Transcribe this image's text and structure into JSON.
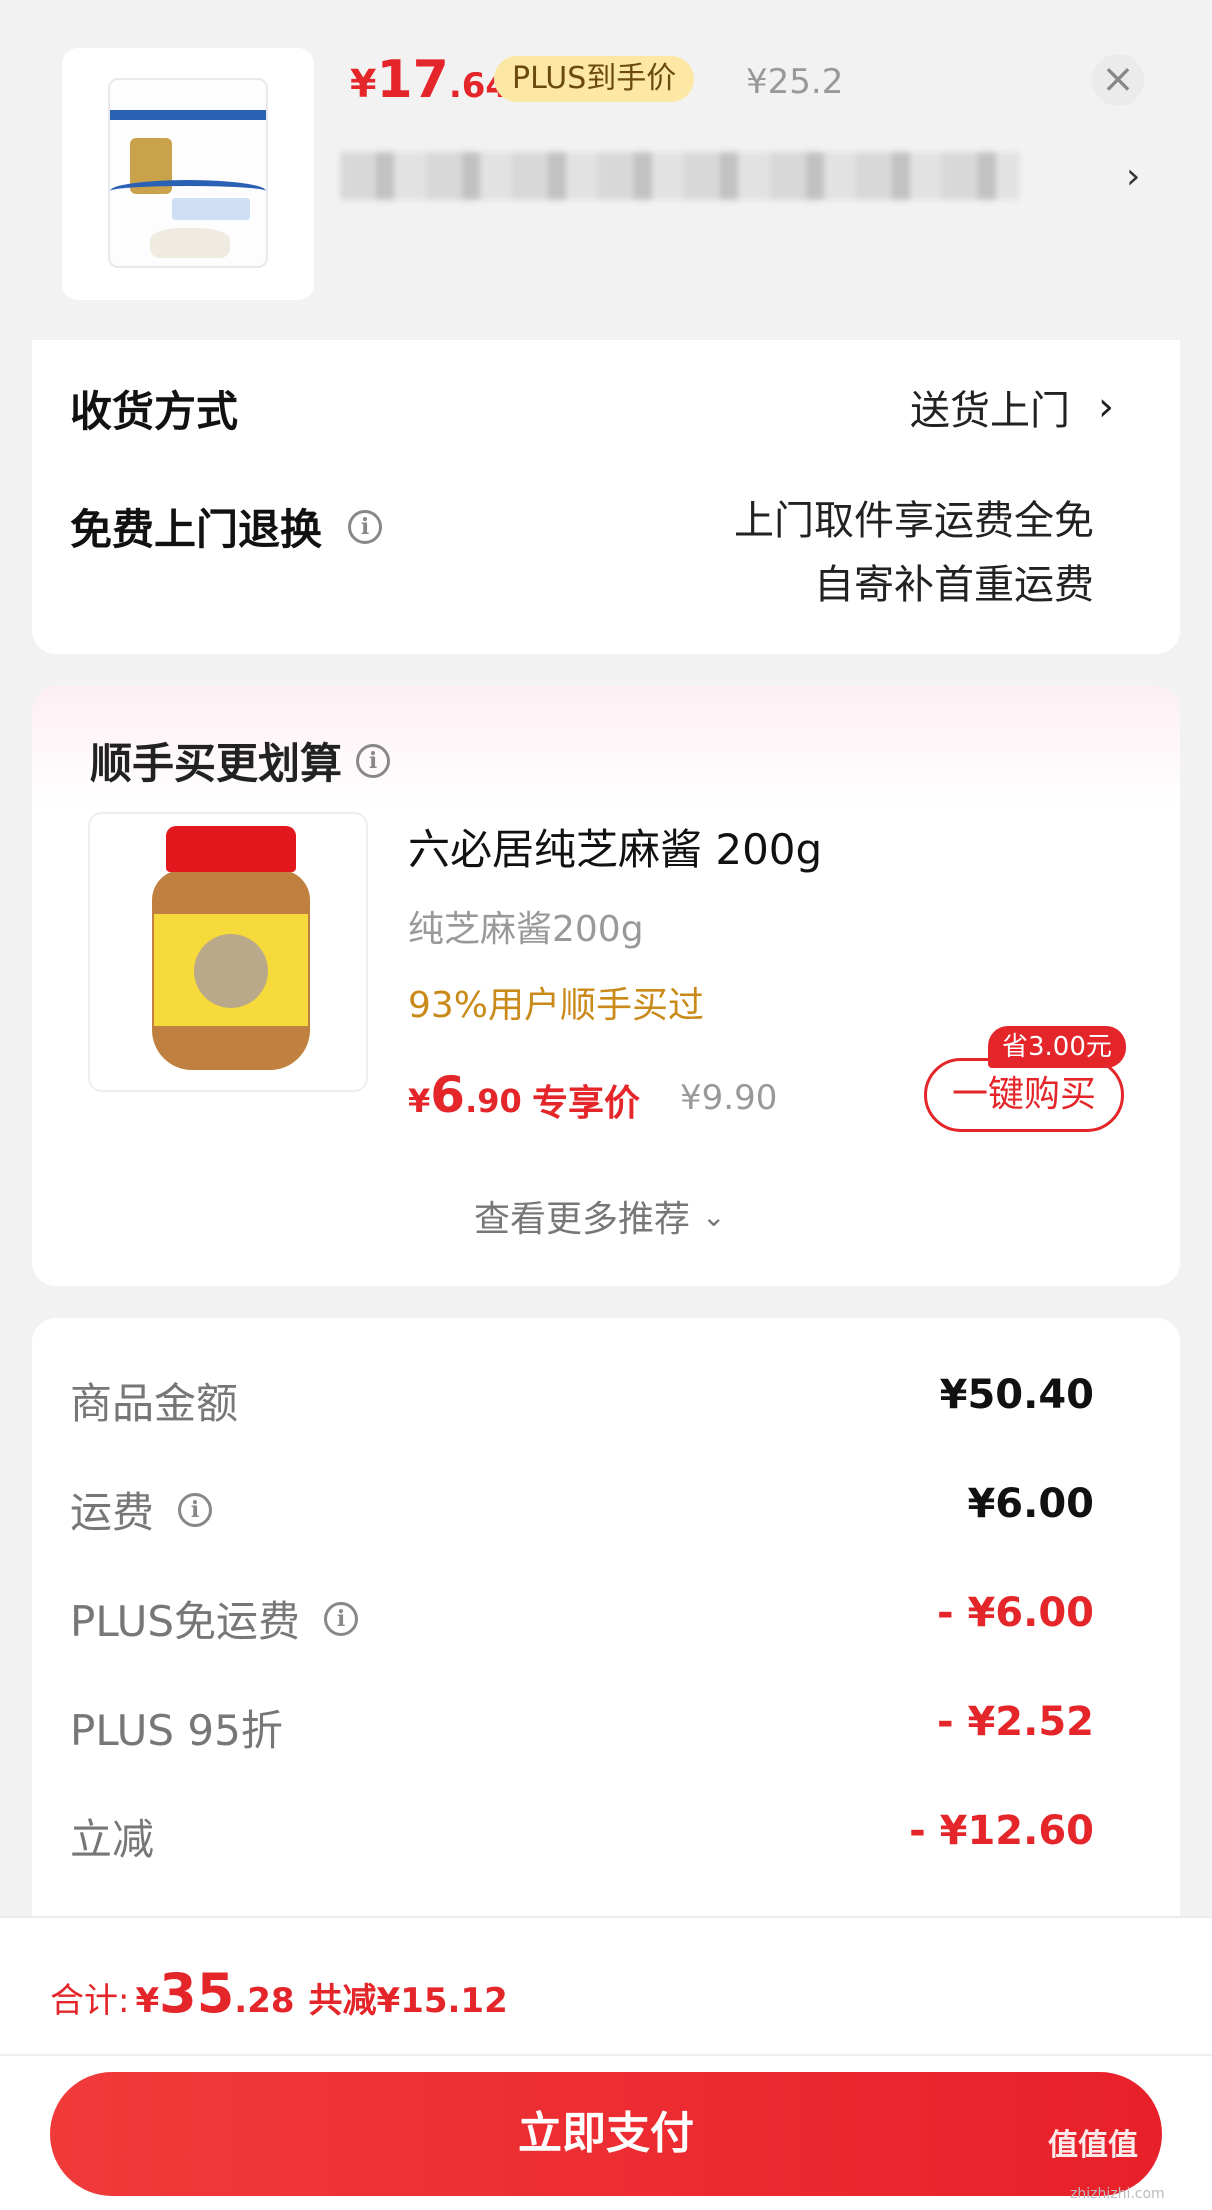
{
  "header": {
    "price_symbol": "¥",
    "price_int": "17",
    "price_dec": ".64",
    "plus_badge": "PLUS到手价",
    "original_price": "¥25.2",
    "close_icon": "close-icon",
    "chevron_icon": "chevron-right-icon"
  },
  "delivery": {
    "method_label": "收货方式",
    "method_value": "送货上门",
    "return_label": "免费上门退换",
    "return_line1": "上门取件享运费全免",
    "return_line2": "自寄补首重运费"
  },
  "addon": {
    "title": "顺手买更划算",
    "product_name": "六必居纯芝麻酱 200g",
    "product_spec": "纯芝麻酱200g",
    "bought_rate": "93%用户顺手买过",
    "price_symbol": "¥",
    "price_int": "6",
    "price_dec": ".90",
    "price_tag": "专享价",
    "original_price": "¥9.90",
    "save_badge": "省3.00元",
    "buy_button": "一键购买",
    "more": "查看更多推荐"
  },
  "fees": [
    {
      "label": "商品金额",
      "value": "¥50.40",
      "info": false,
      "highlight": false
    },
    {
      "label": "运费",
      "value": "¥6.00",
      "info": true,
      "highlight": false
    },
    {
      "label": "PLUS免运费",
      "value": "- ¥6.00",
      "info": true,
      "highlight": true
    },
    {
      "label": "PLUS 95折",
      "value": "- ¥2.52",
      "info": false,
      "highlight": true
    },
    {
      "label": "立减",
      "value": "- ¥12.60",
      "info": false,
      "highlight": true
    }
  ],
  "footer": {
    "total_label": "合计:",
    "total_symbol": "¥",
    "total_int": "35",
    "total_dec": ".28",
    "total_saved": "共减¥15.12",
    "pay_button": "立即支付",
    "watermark": "值值值",
    "watermark_url": "zhizhizhi.com"
  },
  "colors": {
    "accent": "#e4262a",
    "plus_badge_bg": "#fde7a4",
    "bought_text": "#c98a1a"
  }
}
